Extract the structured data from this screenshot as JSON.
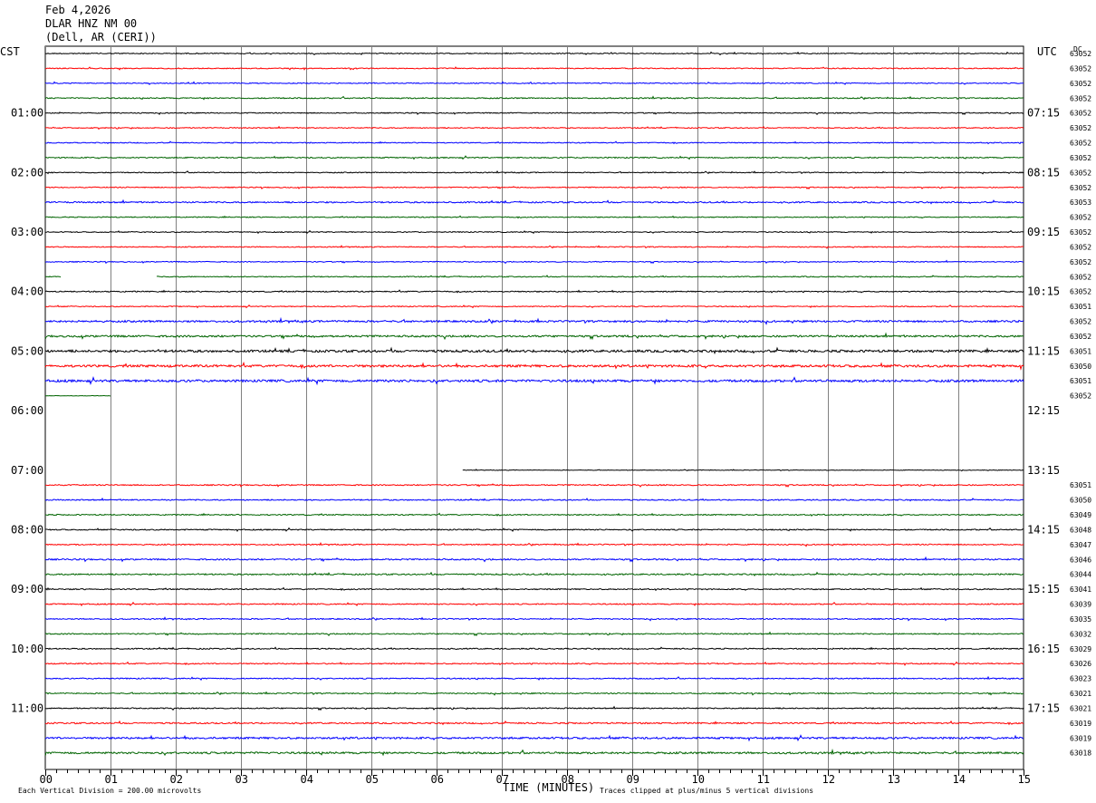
{
  "header": {
    "date": "Feb 4,2026",
    "station": "DLAR HNZ NM 00",
    "location": "(Dell, AR (CERI))"
  },
  "left_zone_label": "CST",
  "right_zone_label": "UTC",
  "dc_label": "DC",
  "footer": {
    "scale_note": "Each Vertical Division =  200.00 microvolts",
    "xlabel": "TIME (MINUTES)",
    "clip_note": "Traces clipped at plus/minus 5 vertical divisions"
  },
  "colors": {
    "trace_cycle": [
      "#000000",
      "#ff0000",
      "#0000ff",
      "#006400"
    ],
    "grid": "#808080"
  },
  "chart_data": {
    "type": "line",
    "title": "DLAR HNZ NM 00",
    "xlabel": "TIME (MINUTES)",
    "xlim": [
      0,
      15
    ],
    "x_ticks": [
      "00",
      "01",
      "02",
      "03",
      "04",
      "05",
      "06",
      "07",
      "08",
      "09",
      "10",
      "11",
      "12",
      "13",
      "14",
      "15"
    ],
    "row_minutes": 15,
    "left_hour_labels": [
      "01:00",
      "02:00",
      "03:00",
      "04:00",
      "05:00",
      "06:00",
      "07:00",
      "08:00",
      "09:00",
      "10:00",
      "11:00"
    ],
    "right_hour_labels": [
      "07:15",
      "08:15",
      "09:15",
      "10:15",
      "11:15",
      "12:15",
      "13:15",
      "14:15",
      "15:15",
      "16:15",
      "17:15"
    ],
    "traces": [
      {
        "dc": "63052",
        "amp": 1,
        "start": 0,
        "end": 15
      },
      {
        "dc": "63052",
        "amp": 1,
        "start": 0,
        "end": 15
      },
      {
        "dc": "63052",
        "amp": 1,
        "start": 0,
        "end": 15
      },
      {
        "dc": "63052",
        "amp": 1.2,
        "start": 0,
        "end": 15
      },
      {
        "dc": "63052",
        "amp": 1,
        "start": 0,
        "end": 15
      },
      {
        "dc": "63052",
        "amp": 1,
        "start": 0,
        "end": 15
      },
      {
        "dc": "63052",
        "amp": 1,
        "start": 0,
        "end": 15
      },
      {
        "dc": "63052",
        "amp": 1.2,
        "start": 0,
        "end": 15
      },
      {
        "dc": "63052",
        "amp": 1,
        "start": 0,
        "end": 15
      },
      {
        "dc": "63052",
        "amp": 1,
        "start": 0,
        "end": 15
      },
      {
        "dc": "63053",
        "amp": 1.5,
        "start": 0,
        "end": 15
      },
      {
        "dc": "63052",
        "amp": 1,
        "start": 0,
        "end": 15
      },
      {
        "dc": "63052",
        "amp": 1,
        "start": 0,
        "end": 15
      },
      {
        "dc": "63052",
        "amp": 1,
        "start": 0,
        "end": 15
      },
      {
        "dc": "63052",
        "amp": 1,
        "start": 0,
        "end": 15
      },
      {
        "dc": "63052",
        "amp": 1,
        "start": 0,
        "end": 15,
        "gaps": [
          [
            0.25,
            1.7
          ]
        ]
      },
      {
        "dc": "63052",
        "amp": 1.2,
        "start": 0,
        "end": 15
      },
      {
        "dc": "63051",
        "amp": 1,
        "start": 0,
        "end": 15
      },
      {
        "dc": "63052",
        "amp": 2,
        "start": 0,
        "end": 15
      },
      {
        "dc": "63052",
        "amp": 2,
        "start": 0,
        "end": 15
      },
      {
        "dc": "63051",
        "amp": 2.5,
        "start": 0,
        "end": 15
      },
      {
        "dc": "63050",
        "amp": 2.5,
        "start": 0,
        "end": 15
      },
      {
        "dc": "63051",
        "amp": 2.5,
        "start": 0,
        "end": 15
      },
      {
        "dc": "63052",
        "amp": 0.5,
        "start": 0,
        "end": 1.0
      },
      {
        "dc": "",
        "amp": 0,
        "start": 0,
        "end": 0
      },
      {
        "dc": "",
        "amp": 0,
        "start": 0,
        "end": 0
      },
      {
        "dc": "",
        "amp": 0,
        "start": 0,
        "end": 0
      },
      {
        "dc": "",
        "amp": 0,
        "start": 0,
        "end": 0
      },
      {
        "dc": "",
        "amp": 0.6,
        "start": 6.4,
        "end": 15
      },
      {
        "dc": "63051",
        "amp": 1.2,
        "start": 0,
        "end": 15
      },
      {
        "dc": "63050",
        "amp": 1.2,
        "start": 0,
        "end": 15
      },
      {
        "dc": "63049",
        "amp": 1.2,
        "start": 0,
        "end": 15
      },
      {
        "dc": "63048",
        "amp": 1.2,
        "start": 0,
        "end": 15
      },
      {
        "dc": "63047",
        "amp": 1.2,
        "start": 0,
        "end": 15
      },
      {
        "dc": "63046",
        "amp": 1.5,
        "start": 0,
        "end": 15
      },
      {
        "dc": "63044",
        "amp": 1.5,
        "start": 0,
        "end": 15
      },
      {
        "dc": "63041",
        "amp": 1.2,
        "start": 0,
        "end": 15
      },
      {
        "dc": "63039",
        "amp": 1.2,
        "start": 0,
        "end": 15
      },
      {
        "dc": "63035",
        "amp": 1.2,
        "start": 0,
        "end": 15
      },
      {
        "dc": "63032",
        "amp": 1.2,
        "start": 0,
        "end": 15
      },
      {
        "dc": "63029",
        "amp": 1.2,
        "start": 0,
        "end": 15
      },
      {
        "dc": "63026",
        "amp": 1.2,
        "start": 0,
        "end": 15
      },
      {
        "dc": "63023",
        "amp": 1.2,
        "start": 0,
        "end": 15
      },
      {
        "dc": "63021",
        "amp": 1.2,
        "start": 0,
        "end": 15
      },
      {
        "dc": "63021",
        "amp": 1.2,
        "start": 0,
        "end": 15
      },
      {
        "dc": "63019",
        "amp": 1.5,
        "start": 0,
        "end": 15
      },
      {
        "dc": "63019",
        "amp": 2,
        "start": 0,
        "end": 15
      },
      {
        "dc": "63018",
        "amp": 2,
        "start": 0,
        "end": 15
      }
    ]
  }
}
